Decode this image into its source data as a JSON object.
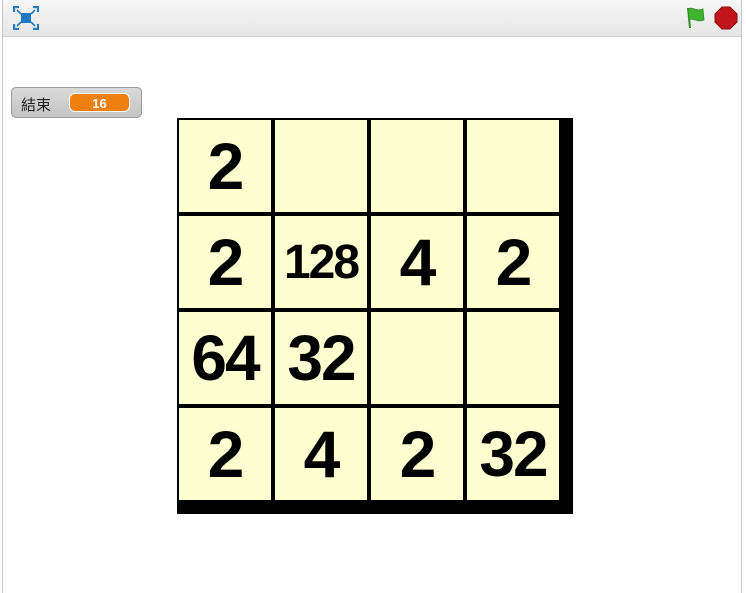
{
  "toolbar": {
    "fullscreen_icon": "fullscreen-icon",
    "flag_icon": "green-flag-icon",
    "stop_icon": "stop-sign-icon",
    "flag_color": "#3fb52f",
    "stop_color": "#c0141a"
  },
  "monitor": {
    "label": "結束",
    "value": "16",
    "value_color": "#f07f12"
  },
  "board": {
    "tile_color": "#ffffd2",
    "border_color": "#000000",
    "rows": [
      [
        "2",
        "",
        "",
        ""
      ],
      [
        "2",
        "128",
        "4",
        "2"
      ],
      [
        "64",
        "32",
        "",
        ""
      ],
      [
        "2",
        "4",
        "2",
        "32"
      ]
    ]
  }
}
